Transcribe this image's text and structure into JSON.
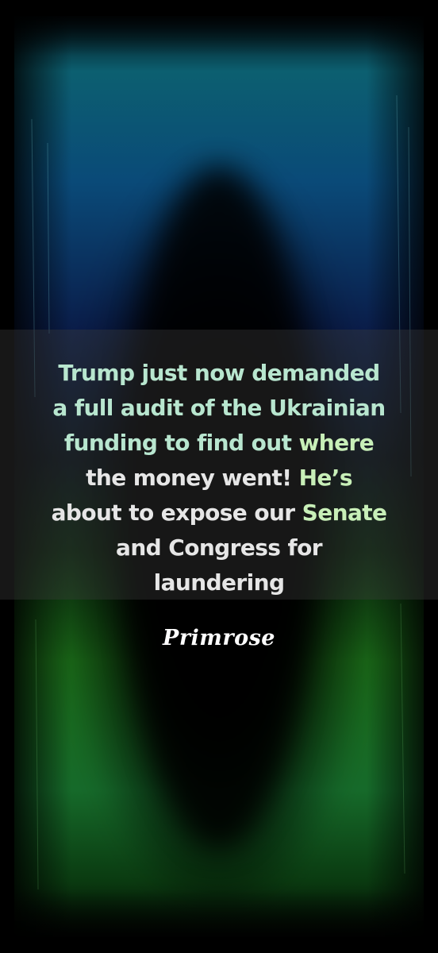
{
  "caption": {
    "lines": [
      [
        {
          "text": "Trump just now demanded",
          "tint": "mint"
        }
      ],
      [
        {
          "text": "a full audit of the Ukrainian",
          "tint": "mint"
        }
      ],
      [
        {
          "text": "funding to find out ",
          "tint": "mint"
        },
        {
          "text": "where",
          "tint": "green"
        }
      ],
      [
        {
          "text": "the money went! ",
          "tint": "plain"
        },
        {
          "text": "He’s",
          "tint": "green"
        }
      ],
      [
        {
          "text": "about to expose our ",
          "tint": "plain"
        },
        {
          "text": "Senate",
          "tint": "green"
        }
      ],
      [
        {
          "text": "and Congress for",
          "tint": "plain"
        }
      ],
      [
        {
          "text": "laundering",
          "tint": "plain"
        }
      ]
    ]
  },
  "signature": "Primrose",
  "colors": {
    "caption_text": "#e6e6e6",
    "caption_text_mint": "#b8e6cf",
    "caption_text_green": "#c8efb8",
    "caption_band": "rgba(60,60,60,0.38)",
    "signature": "#ffffff",
    "background_top": "#0b6b74",
    "background_bottom": "#1f7a1c",
    "background_center": "#000000"
  }
}
